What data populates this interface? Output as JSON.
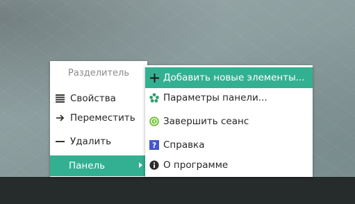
{
  "main_menu": {
    "separator": "Разделитель",
    "items": [
      {
        "label": "Свойства",
        "icon": "properties-icon"
      },
      {
        "label": "Переместить",
        "icon": "arrow-right-icon"
      },
      {
        "label": "Удалить",
        "icon": "minus-icon"
      },
      {
        "label": "Панель",
        "icon": ""
      }
    ]
  },
  "sub_menu": {
    "items": [
      {
        "label": "Добавить новые элементы...",
        "icon": "plus-icon"
      },
      {
        "label": "Параметры панели...",
        "icon": "panel-settings-icon"
      },
      {
        "label": "Завершить сеанс",
        "icon": "logout-icon"
      },
      {
        "label": "Справка",
        "icon": "help-icon"
      },
      {
        "label": "О программе",
        "icon": "info-icon"
      }
    ]
  },
  "colors": {
    "highlight": "#33b092",
    "taskbar": "#262b2b"
  }
}
